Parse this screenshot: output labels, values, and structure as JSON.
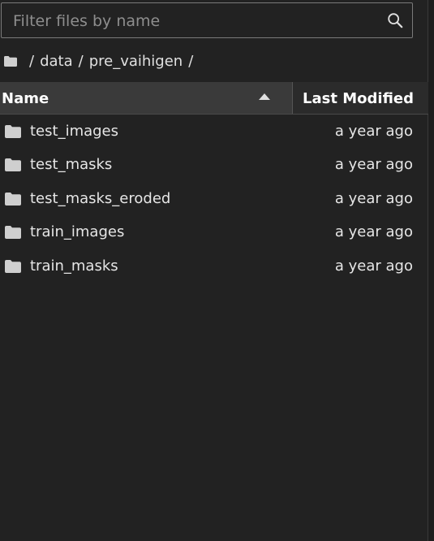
{
  "search": {
    "placeholder": "Filter files by name",
    "value": "",
    "icon": "search-icon"
  },
  "breadcrumb": {
    "root_icon": "folder-icon",
    "separator": "/",
    "parts": [
      "data",
      "pre_vaihigen"
    ]
  },
  "table": {
    "columns": {
      "name": "Name",
      "modified": "Last Modified",
      "sort": "ascending"
    },
    "rows": [
      {
        "name": "test_images",
        "modified": "a year ago",
        "type": "folder"
      },
      {
        "name": "test_masks",
        "modified": "a year ago",
        "type": "folder"
      },
      {
        "name": "test_masks_eroded",
        "modified": "a year ago",
        "type": "folder"
      },
      {
        "name": "train_images",
        "modified": "a year ago",
        "type": "folder"
      },
      {
        "name": "train_masks",
        "modified": "a year ago",
        "type": "folder"
      }
    ]
  },
  "colors": {
    "background": "#222222",
    "header_active": "#3a3a3a",
    "text": "#e6e6e6",
    "icon": "#cfcfcf"
  }
}
